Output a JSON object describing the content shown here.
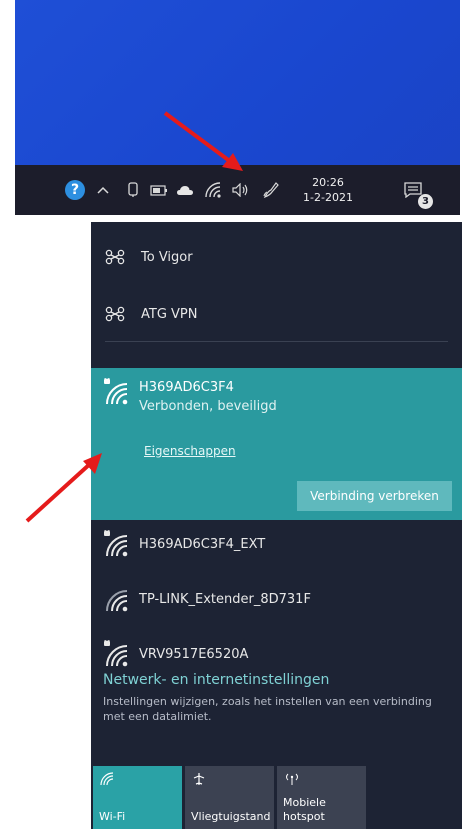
{
  "taskbar": {
    "icons": [
      "help-icon",
      "chevron-up-icon",
      "pen-icon",
      "battery-icon",
      "onedrive-icon",
      "wifi-icon",
      "volume-icon",
      "pen-workspace-icon",
      "notification-icon"
    ],
    "help_glyph": "?",
    "time": "20:26",
    "date": "1-2-2021",
    "notification_count": "3"
  },
  "vpn": {
    "items": [
      {
        "label": "To Vigor"
      },
      {
        "label": "ATG VPN"
      }
    ]
  },
  "active_network": {
    "ssid": "H369AD6C3F4",
    "status": "Verbonden, beveiligd",
    "properties_link": "Eigenschappen",
    "disconnect_button": "Verbinding verbreken"
  },
  "networks": [
    {
      "ssid": "H369AD6C3F4_EXT",
      "secured": true
    },
    {
      "ssid": "TP-LINK_Extender_8D731F",
      "secured": false
    },
    {
      "ssid": "VRV9517E6520A",
      "secured": true
    }
  ],
  "settings": {
    "title": "Netwerk- en internetinstellingen",
    "description": "Instellingen wijzigen, zoals het instellen van een verbinding met een datalimiet."
  },
  "quick_actions": [
    {
      "label": "Wi-Fi",
      "active": true
    },
    {
      "label": "Vliegtuigstand",
      "active": false
    },
    {
      "label": "Mobiele hotspot",
      "active": false
    }
  ],
  "colors": {
    "desktop": "#1f4fd6",
    "taskbar": "#1c1d2b",
    "flyout": "#1d2334",
    "accent": "#2a9a9f",
    "link": "#7fd1d4",
    "arrow": "#e51b1b"
  }
}
